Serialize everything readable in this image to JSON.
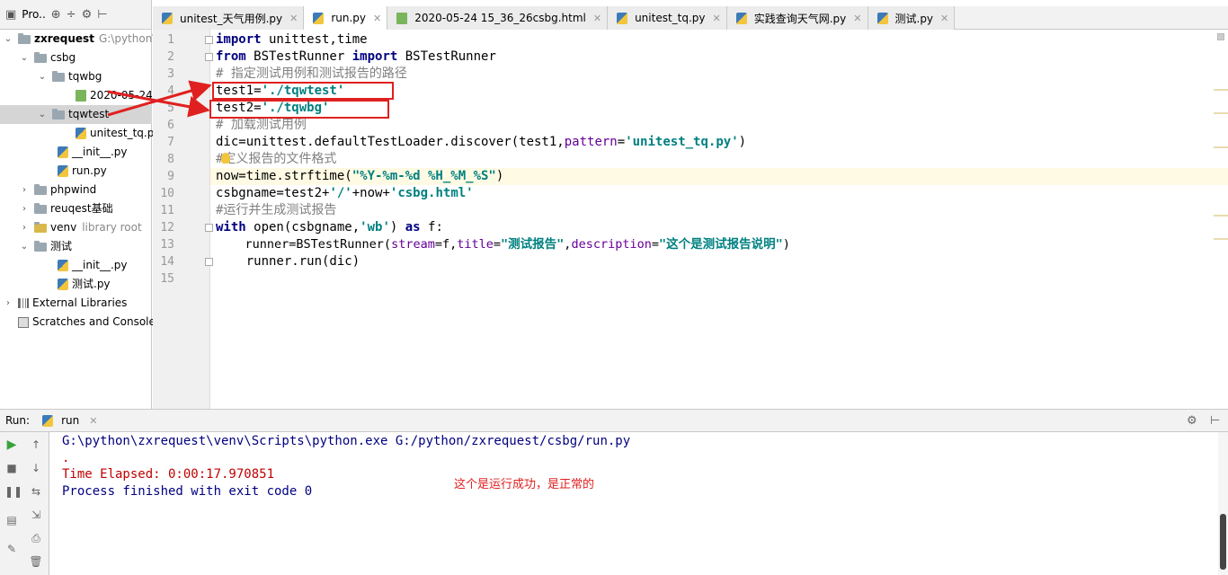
{
  "project": {
    "title": "Pro..",
    "tree": [
      {
        "label": "zxrequest",
        "extra": "G:\\python\\z"
      },
      {
        "label": "csbg"
      },
      {
        "label": "tqwbg"
      },
      {
        "label": "2020-05-24"
      },
      {
        "label": "tqwtest"
      },
      {
        "label": "unitest_tq.py"
      },
      {
        "label": "__init__.py"
      },
      {
        "label": "run.py"
      },
      {
        "label": "phpwind"
      },
      {
        "label": "reuqest基础"
      },
      {
        "label": "venv",
        "extra": "library root"
      },
      {
        "label": "测试"
      },
      {
        "label": "__init__.py"
      },
      {
        "label": "测试.py"
      },
      {
        "label": "External Libraries"
      },
      {
        "label": "Scratches and Consoles"
      }
    ]
  },
  "tabs": [
    {
      "label": "unitest_天气用例.py"
    },
    {
      "label": "run.py"
    },
    {
      "label": "2020-05-24 15_36_26csbg.html"
    },
    {
      "label": "unitest_tq.py"
    },
    {
      "label": "实践查询天气网.py"
    },
    {
      "label": "测试.py"
    }
  ],
  "editor": {
    "line_numbers": [
      "1",
      "2",
      "3",
      "4",
      "5",
      "6",
      "7",
      "8",
      "9",
      "10",
      "11",
      "12",
      "13",
      "14",
      "15"
    ],
    "code": {
      "l1_kw": "import",
      "l1_rest": " unittest,time",
      "l2_kw1": "from",
      "l2_mid": " BSTestRunner ",
      "l2_kw2": "import",
      "l2_rest": " BSTestRunner",
      "l3": "# 指定测试用例和测试报告的路径",
      "l4_a": "test1=",
      "l4_str": "'./tqwtest'",
      "l5_a": "test2=",
      "l5_str": "'./tqwbg'",
      "l6": "# 加载测试用例",
      "l7_a": "dic=unittest.defaultTestLoader.discover(test1,",
      "l7_param": "pattern",
      "l7_eq": "=",
      "l7_str": "'unitest_tq.py'",
      "l7_end": ")",
      "l8": "#定义报告的文件格式",
      "l9_a": "now=time.strftime(",
      "l9_str": "\"%Y-%m-%d %H_%M_%S\"",
      "l9_end": ")",
      "l10_a": "csbgname=test2+",
      "l10_s1": "'/'",
      "l10_b": "+now+",
      "l10_s2": "'csbg.html'",
      "l11": "#运行并生成测试报告",
      "l12_kw": "with",
      "l12_a": " open(csbgname,",
      "l12_str": "'wb'",
      "l12_b": ") ",
      "l12_kw2": "as",
      "l12_c": " f:",
      "l13_a": "    runner=BSTestRunner(",
      "l13_p1": "stream",
      "l13_b": "=f,",
      "l13_p2": "title",
      "l13_eq": "=",
      "l13_s1": "\"测试报告\"",
      "l13_c": ",",
      "l13_p3": "description",
      "l13_eq2": "=",
      "l13_s2": "\"这个是测试报告说明\"",
      "l13_end": ")",
      "l14": "    runner.run(dic)"
    }
  },
  "run": {
    "label": "Run:",
    "tab": "run",
    "console": [
      "G:\\python\\zxrequest\\venv\\Scripts\\python.exe G:/python/zxrequest/csbg/run.py",
      ".",
      "Time Elapsed: 0:00:17.970851",
      "Process finished with exit code 0"
    ],
    "note": "这个是运行成功，是正常的"
  },
  "colors": {
    "annotation": "#e02020",
    "keyword": "#000080",
    "string": "#008080"
  }
}
